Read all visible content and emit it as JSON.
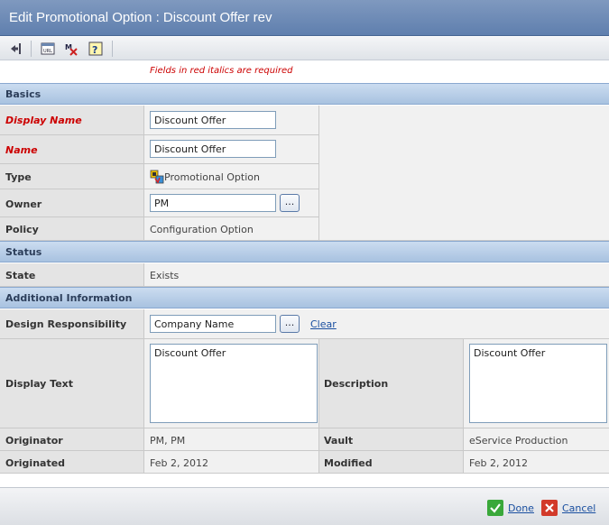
{
  "window": {
    "title": "Edit Promotional Option : Discount Offer rev"
  },
  "toolbar": {
    "items": [
      {
        "icon": "back-arrow-icon"
      },
      {
        "icon": "url-icon"
      },
      {
        "icon": "mark-remove-icon"
      },
      {
        "icon": "help-icon"
      }
    ]
  },
  "notice": {
    "required_text": "Fields in red italics are required",
    "color": "#cc0000"
  },
  "sections": {
    "basics": "Basics",
    "status": "Status",
    "additional": "Additional Information"
  },
  "fields": {
    "display_name": {
      "label": "Display Name",
      "value": "Discount Offer"
    },
    "name": {
      "label": "Name",
      "value": "Discount Offer"
    },
    "type": {
      "label": "Type",
      "value": "Promotional Option",
      "icon": "promotional-option-icon"
    },
    "owner": {
      "label": "Owner",
      "value": "PM",
      "chooser": "..."
    },
    "policy": {
      "label": "Policy",
      "value": "Configuration Option"
    },
    "state": {
      "label": "State",
      "value": "Exists"
    },
    "design_responsibility": {
      "label": "Design Responsibility",
      "value": "Company Name",
      "chooser": "...",
      "clear": "Clear"
    },
    "display_text": {
      "label": "Display Text",
      "value": "Discount Offer"
    },
    "description": {
      "label": "Description",
      "value": "Discount Offer"
    },
    "originator": {
      "label": "Originator",
      "value": "PM, PM"
    },
    "vault": {
      "label": "Vault",
      "value": "eService Production"
    },
    "originated": {
      "label": "Originated",
      "value": "Feb 2, 2012"
    },
    "modified": {
      "label": "Modified",
      "value": "Feb 2, 2012"
    }
  },
  "footer": {
    "done": "Done",
    "cancel": "Cancel",
    "done_color": "#3aa83a",
    "cancel_color": "#d23a2a"
  }
}
